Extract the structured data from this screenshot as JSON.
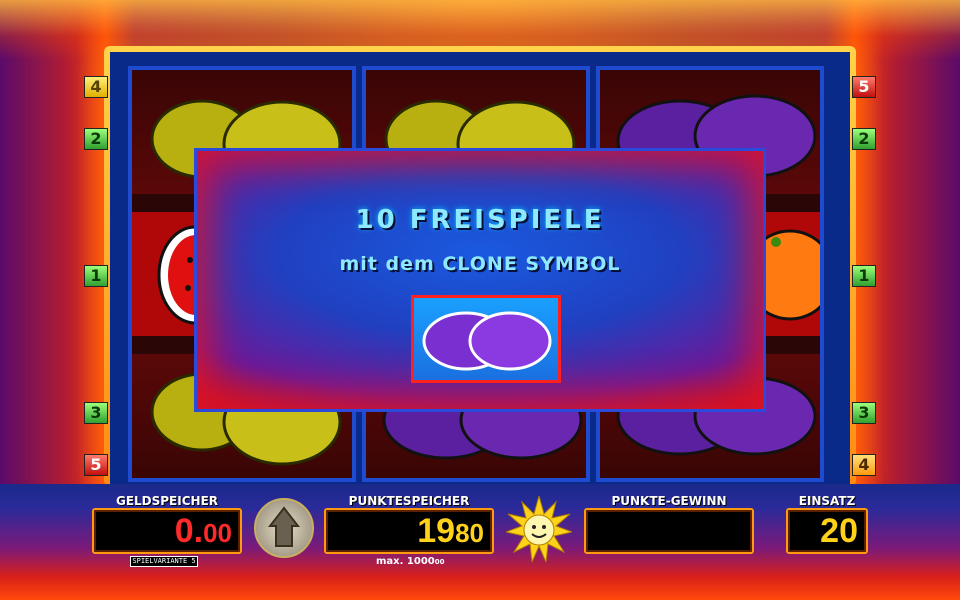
{
  "popup": {
    "title": "10 FREISPIELE",
    "subtitle": "mit dem CLONE SYMBOL",
    "clone_symbol": "plum-icon"
  },
  "reels": [
    {
      "symbols": [
        "lemon-icon",
        "watermelon-icon",
        "lemon-icon"
      ]
    },
    {
      "symbols": [
        "lemon-icon",
        "hidden",
        "plum-icon"
      ]
    },
    {
      "symbols": [
        "plum-icon",
        "orange-icon",
        "plum-icon"
      ]
    }
  ],
  "paylines": {
    "left": [
      "4",
      "2",
      "1",
      "3",
      "5"
    ],
    "right": [
      "5",
      "2",
      "1",
      "3",
      "4"
    ]
  },
  "panel": {
    "geldspeicher_label": "GELDSPEICHER (EURO)",
    "geldspeicher_main": "0.",
    "geldspeicher_cents": "00",
    "spielvariante": "SPIELVARIANTE 5",
    "punktespeicher_label": "PUNKTESPEICHER",
    "punktespeicher_main": "19",
    "punktespeicher_small": "80",
    "max_label": "max. 1000",
    "max_small": "00",
    "punkte_gewinn_label": "PUNKTE-GEWINN",
    "punkte_gewinn_value": "",
    "einsatz_label": "EINSATZ",
    "einsatz_value": "20"
  },
  "colors": {
    "accent": "#ffd21a",
    "frame": "#ff9a10",
    "popup_text": "#8ee8ff"
  }
}
